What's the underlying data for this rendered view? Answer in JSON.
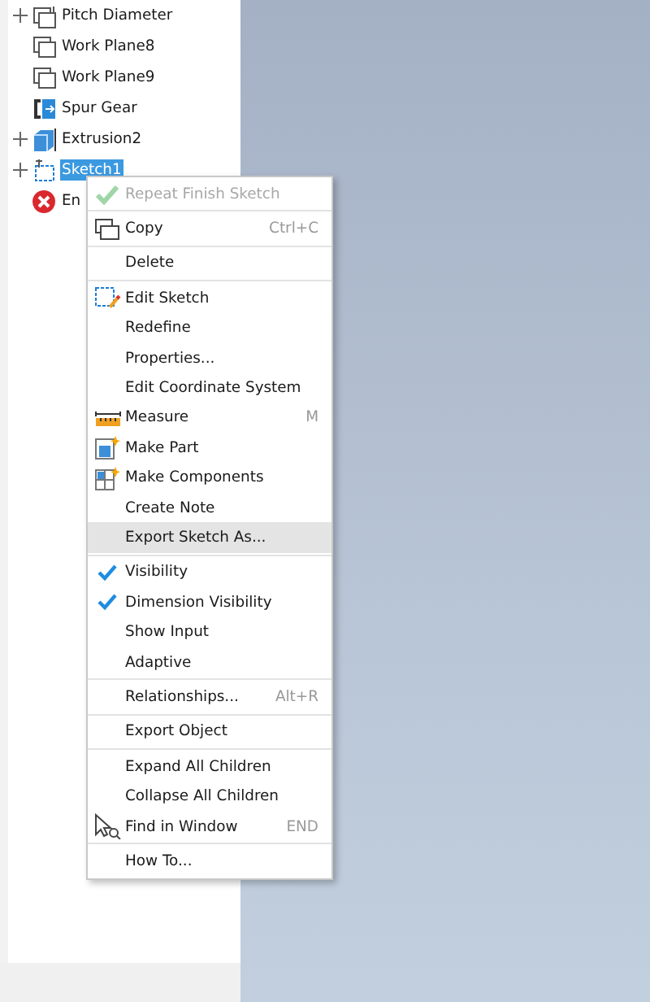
{
  "tree": {
    "items": [
      {
        "label": "Pitch Diameter",
        "expandable": true,
        "selected": false
      },
      {
        "label": "Work Plane8",
        "expandable": false,
        "selected": false
      },
      {
        "label": "Work Plane9",
        "expandable": false,
        "selected": false
      },
      {
        "label": "Spur Gear",
        "expandable": false,
        "selected": false
      },
      {
        "label": "Extrusion2",
        "expandable": true,
        "selected": false
      },
      {
        "label": "Sketch1",
        "expandable": true,
        "selected": true
      },
      {
        "label": "En",
        "expandable": false,
        "selected": false
      }
    ]
  },
  "context_menu": {
    "groups": [
      [
        {
          "label": "Repeat Finish Sketch",
          "disabled": true,
          "highlighted": false
        }
      ],
      [
        {
          "label": "Copy",
          "shortcut": "Ctrl+C",
          "disabled": false,
          "highlighted": false
        }
      ],
      [
        {
          "label": "Delete",
          "disabled": false,
          "highlighted": false
        }
      ],
      [
        {
          "label": "Edit Sketch",
          "disabled": false,
          "highlighted": false
        },
        {
          "label": "Redefine",
          "disabled": false,
          "highlighted": false
        },
        {
          "label": "Properties...",
          "disabled": false,
          "highlighted": false
        },
        {
          "label": "Edit Coordinate System",
          "disabled": false,
          "highlighted": false
        },
        {
          "label": "Measure",
          "shortcut": "M",
          "disabled": false,
          "highlighted": false
        },
        {
          "label": "Make Part",
          "disabled": false,
          "highlighted": false
        },
        {
          "label": "Make Components",
          "disabled": false,
          "highlighted": false
        },
        {
          "label": "Create Note",
          "disabled": false,
          "highlighted": false
        },
        {
          "label": "Export Sketch As...",
          "disabled": false,
          "highlighted": true
        }
      ],
      [
        {
          "label": "Visibility",
          "checked": true,
          "disabled": false,
          "highlighted": false
        },
        {
          "label": "Dimension Visibility",
          "checked": true,
          "disabled": false,
          "highlighted": false
        },
        {
          "label": "Show Input",
          "checked": false,
          "disabled": false,
          "highlighted": false
        },
        {
          "label": "Adaptive",
          "checked": false,
          "disabled": false,
          "highlighted": false
        }
      ],
      [
        {
          "label": "Relationships...",
          "shortcut": "Alt+R",
          "disabled": false,
          "highlighted": false
        }
      ],
      [
        {
          "label": "Export Object",
          "disabled": false,
          "highlighted": false
        }
      ],
      [
        {
          "label": "Expand All Children",
          "disabled": false,
          "highlighted": false
        },
        {
          "label": "Collapse All Children",
          "disabled": false,
          "highlighted": false
        },
        {
          "label": "Find in Window",
          "shortcut": "END",
          "disabled": false,
          "highlighted": false
        }
      ],
      [
        {
          "label": "How To...",
          "disabled": false,
          "highlighted": false
        }
      ]
    ]
  }
}
